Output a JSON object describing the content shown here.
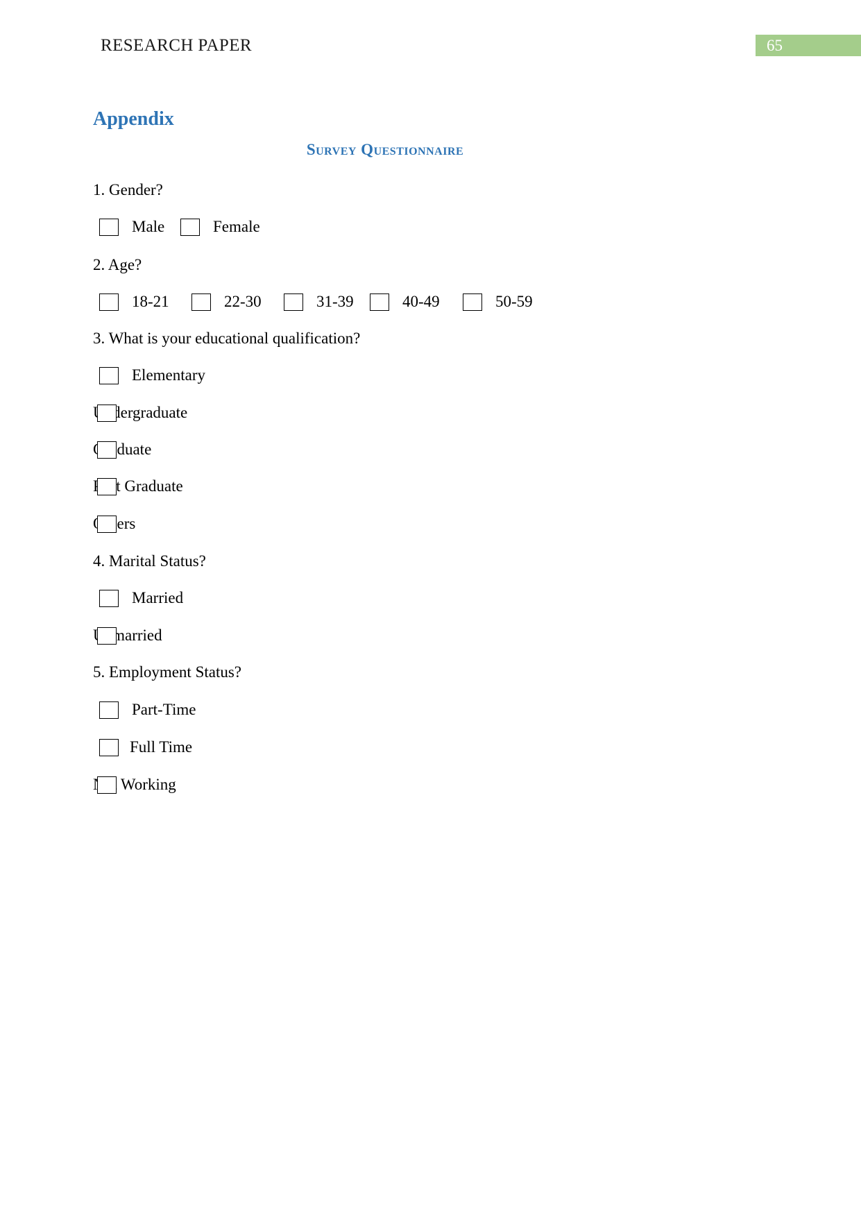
{
  "header": {
    "title": "RESEARCH PAPER",
    "page_number": "65",
    "badge_color": "#a4cd8b"
  },
  "document": {
    "appendix_heading": "Appendix",
    "survey_title": "Survey Questionnaire",
    "heading_color": "#2e74b5"
  },
  "questions": [
    {
      "number": "1",
      "text": "1. Gender?",
      "options": [
        {
          "label": "Male"
        },
        {
          "label": "Female"
        }
      ]
    },
    {
      "number": "2",
      "text": "2. Age?",
      "options": [
        {
          "label": "18-21"
        },
        {
          "label": "22-30"
        },
        {
          "label": "31-39"
        },
        {
          "label": "40-49"
        },
        {
          "label": "50-59"
        }
      ]
    },
    {
      "number": "3",
      "text": "3. What is your educational qualification?",
      "options": [
        {
          "label": "Elementary"
        },
        {
          "label": "Undergraduate"
        },
        {
          "label": "Graduate"
        },
        {
          "label": "Post Graduate"
        },
        {
          "label": "Others"
        }
      ]
    },
    {
      "number": "4",
      "text": "4. Marital Status?",
      "options": [
        {
          "label": "Married"
        },
        {
          "label": "Unmarried"
        }
      ]
    },
    {
      "number": "5",
      "text": "5. Employment Status?",
      "options": [
        {
          "label": "Part-Time"
        },
        {
          "label": "Full Time"
        },
        {
          "label": "Not Working"
        }
      ]
    }
  ]
}
